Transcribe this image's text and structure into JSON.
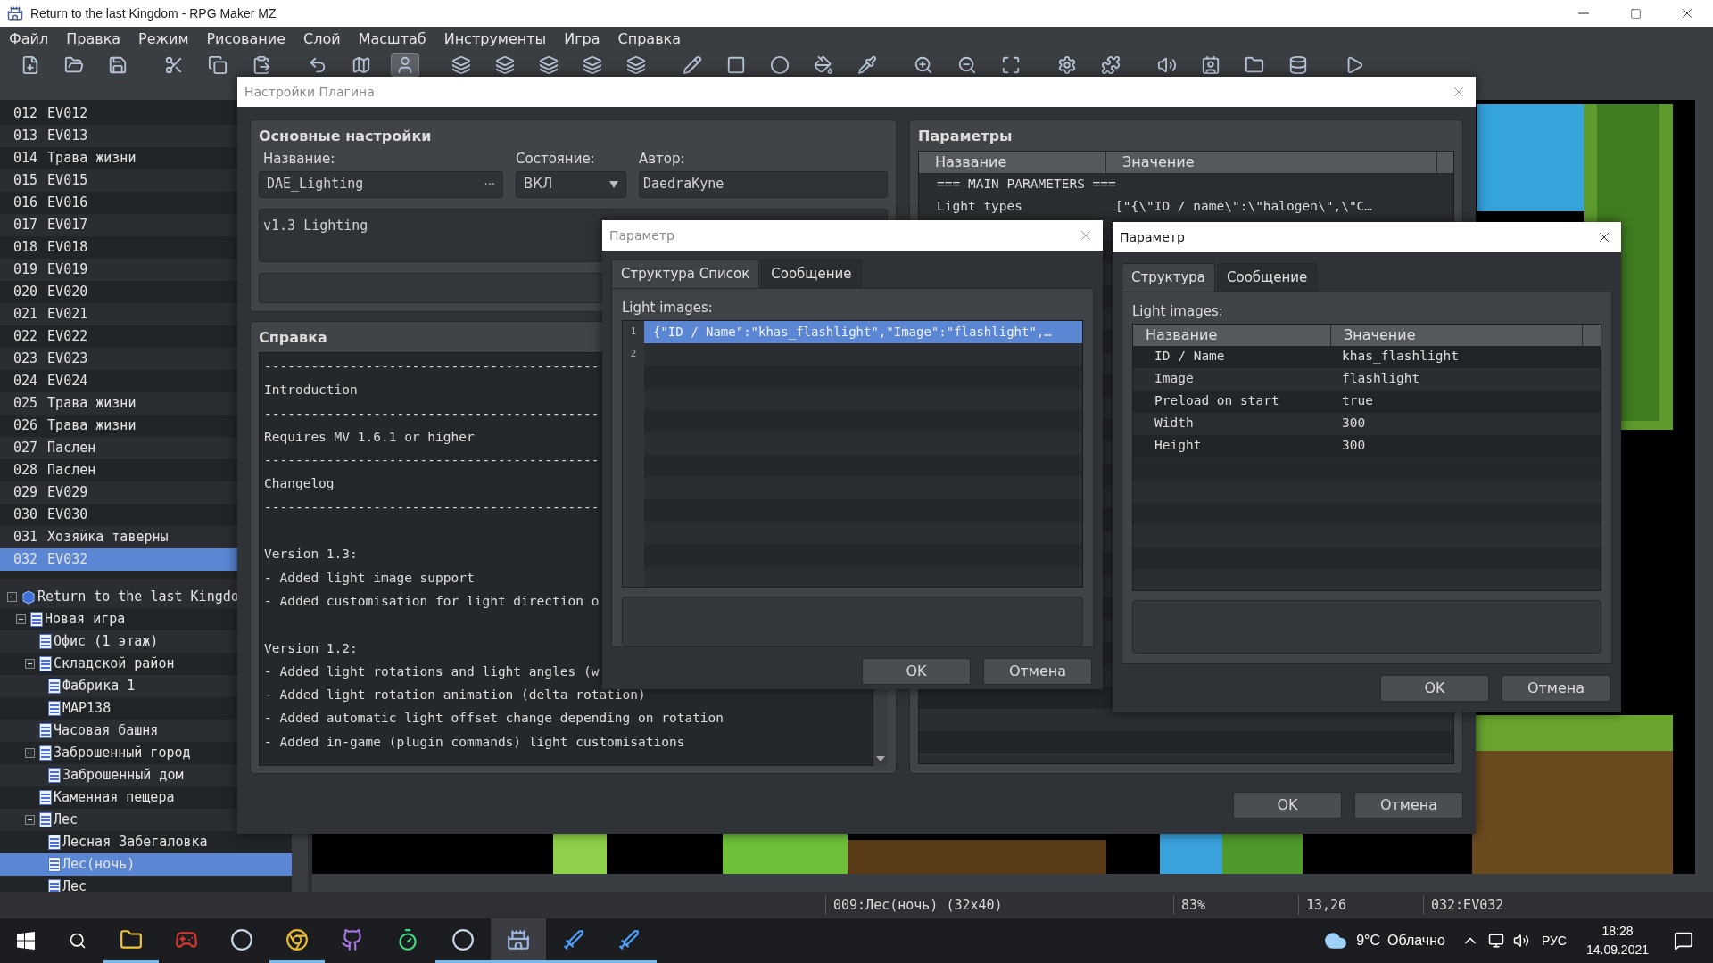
{
  "window": {
    "title": "Return to the last Kingdom - RPG Maker MZ"
  },
  "menu": [
    "Файл",
    "Правка",
    "Режим",
    "Рисование",
    "Слой",
    "Масштаб",
    "Инструменты",
    "Игра",
    "Справка"
  ],
  "toolbar_buttons": [
    {
      "selected": false
    },
    {
      "selected": false
    },
    {
      "selected": false
    },
    {
      "selected": false
    },
    {
      "selected": false
    },
    {
      "selected": false
    },
    {
      "selected": false
    },
    {
      "selected": false
    },
    {
      "selected": true
    },
    {
      "selected": false
    },
    {
      "selected": false
    },
    {
      "selected": false
    },
    {
      "selected": false
    },
    {
      "selected": false
    },
    {
      "selected": false
    },
    {
      "selected": false
    },
    {
      "selected": false
    },
    {
      "selected": false
    },
    {
      "selected": false
    },
    {
      "selected": false
    },
    {
      "selected": false
    },
    {
      "selected": false
    },
    {
      "selected": false
    },
    {
      "selected": false
    },
    {
      "selected": false
    },
    {
      "selected": false
    },
    {
      "selected": false
    },
    {
      "selected": false
    },
    {
      "selected": false
    }
  ],
  "events": [
    {
      "number": "012",
      "name": "EV012",
      "selected": false
    },
    {
      "number": "013",
      "name": "EV013",
      "selected": false
    },
    {
      "number": "014",
      "name": "Трава жизни",
      "selected": false
    },
    {
      "number": "015",
      "name": "EV015",
      "selected": false
    },
    {
      "number": "016",
      "name": "EV016",
      "selected": false
    },
    {
      "number": "017",
      "name": "EV017",
      "selected": false
    },
    {
      "number": "018",
      "name": "EV018",
      "selected": false
    },
    {
      "number": "019",
      "name": "EV019",
      "selected": false
    },
    {
      "number": "020",
      "name": "EV020",
      "selected": false
    },
    {
      "number": "021",
      "name": "EV021",
      "selected": false
    },
    {
      "number": "022",
      "name": "EV022",
      "selected": false
    },
    {
      "number": "023",
      "name": "EV023",
      "selected": false
    },
    {
      "number": "024",
      "name": "EV024",
      "selected": false
    },
    {
      "number": "025",
      "name": "Трава жизни",
      "selected": false
    },
    {
      "number": "026",
      "name": "Трава жизни",
      "selected": false
    },
    {
      "number": "027",
      "name": "Паслен",
      "selected": false
    },
    {
      "number": "028",
      "name": "Паслен",
      "selected": false
    },
    {
      "number": "029",
      "name": "EV029",
      "selected": false
    },
    {
      "number": "030",
      "name": "EV030",
      "selected": false
    },
    {
      "number": "031",
      "name": "Хозяйка таверны",
      "selected": false
    },
    {
      "number": "032",
      "name": "EV032",
      "selected": true
    }
  ],
  "map_tree": [
    {
      "name": "Return to the last Kingdo",
      "kind": "project",
      "expanded": true,
      "selected": false,
      "children": [
        {
          "name": "Новая игра",
          "kind": "map",
          "expanded": true,
          "selected": false,
          "children": [
            {
              "name": "Офис (1 этаж)",
              "kind": "map",
              "selected": false
            },
            {
              "name": "Складской район",
              "kind": "map",
              "expanded": true,
              "selected": false,
              "children": [
                {
                  "name": "Фабрика 1",
                  "kind": "map",
                  "selected": false
                },
                {
                  "name": "MAP138",
                  "kind": "map",
                  "selected": false
                }
              ]
            },
            {
              "name": "Часовая башня",
              "kind": "map",
              "selected": false
            },
            {
              "name": "Заброшенный город",
              "kind": "map",
              "expanded": true,
              "selected": false,
              "children": [
                {
                  "name": "Заброшенный дом",
                  "kind": "map",
                  "selected": false
                }
              ]
            },
            {
              "name": "Каменная пещера",
              "kind": "map",
              "selected": false
            },
            {
              "name": "Лес",
              "kind": "map",
              "expanded": true,
              "selected": false,
              "children": [
                {
                  "name": "Лесная Забегаловка",
                  "kind": "map",
                  "selected": false
                },
                {
                  "name": "Лес(ночь)",
                  "kind": "map",
                  "selected": true
                },
                {
                  "name": "Лес",
                  "kind": "map",
                  "selected": false
                }
              ]
            }
          ]
        }
      ]
    }
  ],
  "plugin_dialog": {
    "title": "Настройки Плагина",
    "active": false,
    "basic": {
      "heading": "Основные настройки",
      "name_label": "Название:",
      "name_value": "DAE_Lighting",
      "name_button": "···",
      "status_label": "Состояние:",
      "status_value": "ВКЛ",
      "author_label": "Автор:",
      "author_value": "DaedraKyne",
      "description": "v1.3 Lighting"
    },
    "help": {
      "heading": "Справка",
      "lines": [
        {
          "text": "-------------------------------------------",
          "gap_before": false
        },
        {
          "text": "Introduction",
          "gap_before": false
        },
        {
          "text": "-------------------------------------------",
          "gap_before": false
        },
        {
          "text": "Requires MV 1.6.1 or higher",
          "gap_before": false
        },
        {
          "text": "-------------------------------------------",
          "gap_before": false
        },
        {
          "text": "Changelog",
          "gap_before": false
        },
        {
          "text": "-------------------------------------------",
          "gap_before": false
        },
        {
          "text": "Version 1.3:",
          "gap_before": true
        },
        {
          "text": "- Added light image support",
          "gap_before": false
        },
        {
          "text": "- Added customisation for light direction o",
          "gap_before": false
        },
        {
          "text": "Version 1.2:",
          "gap_before": true
        },
        {
          "text": "- Added light rotations and light angles (w",
          "gap_before": false
        },
        {
          "text": "- Added light rotation animation (delta rotation)",
          "gap_before": false
        },
        {
          "text": "- Added automatic light offset change depending on rotation",
          "gap_before": false
        },
        {
          "text": "- Added in-game (plugin commands) light customisations",
          "gap_before": false
        }
      ]
    },
    "parameters": {
      "heading": "Параметры",
      "columns": [
        "Название",
        "Значение"
      ],
      "rows": [
        {
          "name": "=== MAIN PARAMETERS ==="
        },
        {
          "name": "Light types",
          "value": "[\"{\\\"ID / name\\\":\\\"halogen\\\",\\\"C…"
        }
      ]
    },
    "buttons": [
      "OK",
      "Отмена"
    ]
  },
  "list_dialog": {
    "title": "Параметр",
    "active": false,
    "tabs": [
      {
        "label": "Структура Список",
        "selected": true
      },
      {
        "label": "Сообщение",
        "selected": false
      }
    ],
    "field_label": "Light images:",
    "lines": [
      {
        "number": "1",
        "text": "{\"ID / Name\":\"khas_flashlight\",\"Image\":\"flashlight\",…",
        "selected": true
      },
      {
        "number": "2",
        "selected": false
      }
    ],
    "buttons": [
      "OK",
      "Отмена"
    ]
  },
  "struct_dialog": {
    "title": "Параметр",
    "active": true,
    "tabs": [
      {
        "label": "Структура",
        "selected": true
      },
      {
        "label": "Сообщение",
        "selected": false
      }
    ],
    "field_label": "Light images:",
    "columns": [
      "Название",
      "Значение"
    ],
    "rows": [
      {
        "name": "ID / Name",
        "value": "khas_flashlight"
      },
      {
        "name": "Image",
        "value": "flashlight"
      },
      {
        "name": "Preload on start",
        "value": "true"
      },
      {
        "name": "Width",
        "value": "300"
      },
      {
        "name": "Height",
        "value": "300"
      }
    ],
    "buttons": [
      "OK",
      "Отмена"
    ]
  },
  "status_bar": [
    "009:Лес(ночь) (32x40)",
    "83%",
    "13,26",
    "032:EV032"
  ],
  "taskbar": {
    "apps": [
      {
        "running": true,
        "selected": false
      },
      {
        "running": false,
        "selected": false
      },
      {
        "running": false,
        "selected": false
      },
      {
        "running": true,
        "selected": false
      },
      {
        "running": false,
        "selected": false
      },
      {
        "running": false,
        "selected": false
      },
      {
        "running": true,
        "selected": false
      },
      {
        "running": true,
        "selected": true
      },
      {
        "running": true,
        "selected": false
      },
      {
        "running": true,
        "selected": false
      }
    ],
    "temperature": "9°C",
    "weather": "Облачно",
    "language": "РУС",
    "time": "18:28",
    "date": "14.09.2021"
  }
}
